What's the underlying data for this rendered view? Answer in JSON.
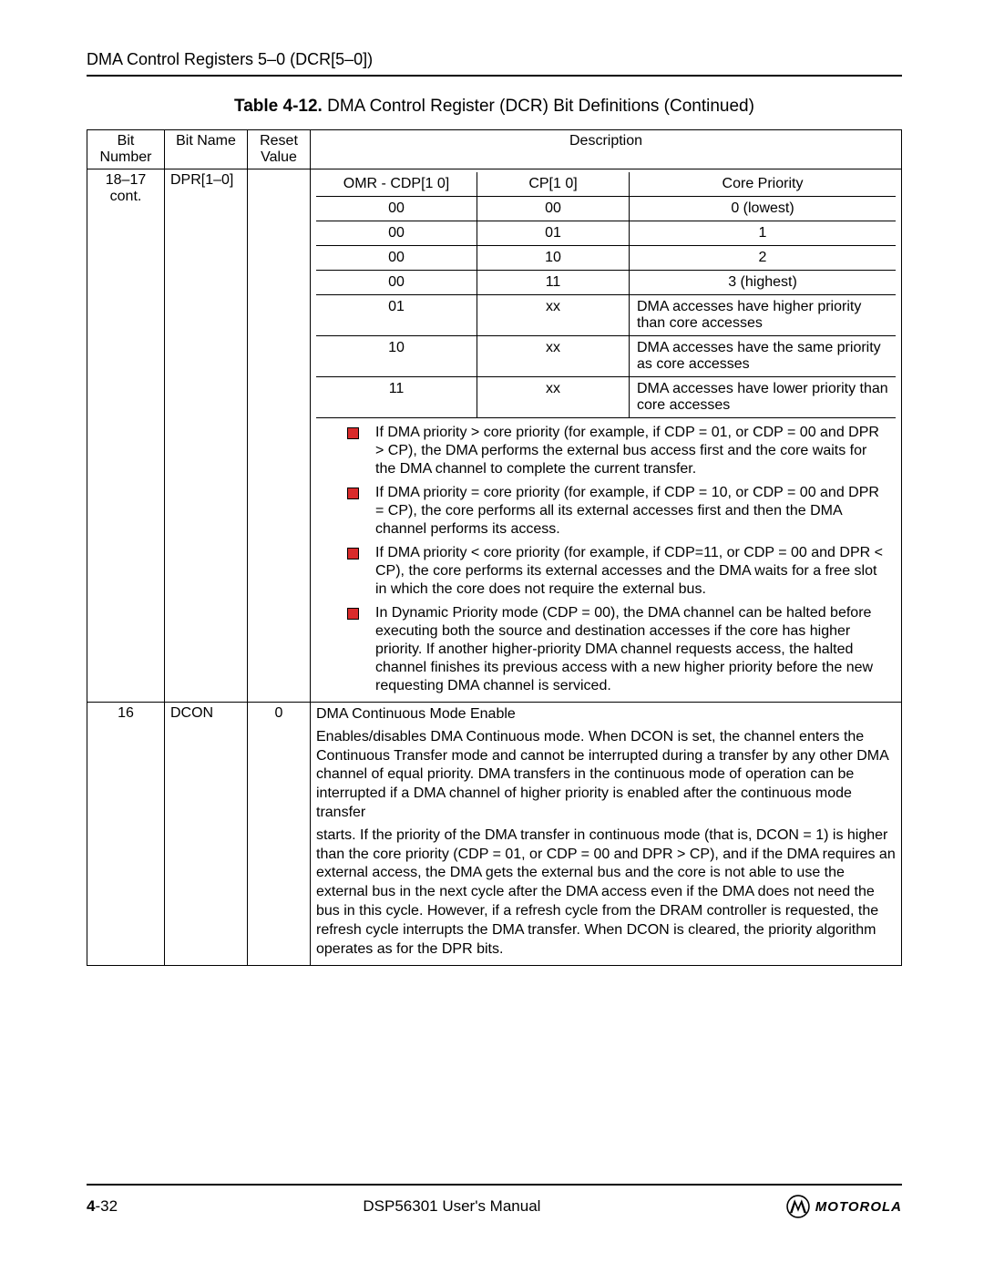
{
  "header": {
    "section_title": "DMA Control Registers 5–0 (DCR[5–0])"
  },
  "caption": {
    "label": "Table 4-12.",
    "title": " DMA Control Register (DCR) Bit Definitions (Continued)"
  },
  "columns": {
    "bit_number": "Bit Number",
    "bit_name": "Bit Name",
    "reset_value": "Reset Value",
    "description": "Description"
  },
  "row1": {
    "bit_number": "18–17 cont.",
    "bit_name": "DPR[1–0]",
    "reset_value": "",
    "inner_headers": {
      "c1": "OMR - CDP[1 0]",
      "c2": "CP[1 0]",
      "c3": "Core Priority"
    },
    "inner_rows": [
      {
        "c1": "00",
        "c2": "00",
        "c3": "0 (lowest)"
      },
      {
        "c1": "00",
        "c2": "01",
        "c3": "1"
      },
      {
        "c1": "00",
        "c2": "10",
        "c3": "2"
      },
      {
        "c1": "00",
        "c2": "11",
        "c3": "3 (highest)"
      },
      {
        "c1": "01",
        "c2": "xx",
        "c3": "DMA accesses have higher priority than core accesses"
      },
      {
        "c1": "10",
        "c2": "xx",
        "c3": "DMA accesses have the same priority as core accesses"
      },
      {
        "c1": "11",
        "c2": "xx",
        "c3": "DMA accesses have lower priority than core accesses"
      }
    ],
    "bullets": [
      "If DMA priority > core priority (for example, if CDP = 01, or CDP = 00 and DPR > CP), the DMA performs the external bus access first and the core waits for the DMA channel to complete the current transfer.",
      "If DMA priority = core priority (for example, if CDP = 10, or CDP = 00 and DPR = CP), the core performs all its external accesses first and then the DMA channel performs its access.",
      "If DMA priority < core priority (for example, if CDP=11, or CDP = 00 and DPR < CP), the core performs its external accesses and the DMA waits for a free slot in which the core does not require the external bus.",
      "In Dynamic Priority mode (CDP = 00), the DMA channel can be halted before executing both the source and destination accesses if the core has higher priority. If another higher-priority DMA channel requests access, the halted channel finishes its previous access with a new higher priority before the new requesting DMA channel is serviced."
    ]
  },
  "row2": {
    "bit_number": "16",
    "bit_name": "DCON",
    "reset_value": "0",
    "title": "DMA Continuous Mode Enable",
    "para1": "Enables/disables DMA Continuous mode. When DCON is set, the channel enters the Continuous Transfer mode and cannot be interrupted during a transfer by any other DMA channel of equal priority. DMA transfers in the continuous mode of operation can be interrupted if a DMA channel of higher priority is enabled after the continuous mode transfer",
    "para2": "starts. If the priority of the DMA transfer in continuous mode (that is, DCON = 1) is higher than the core priority (CDP = 01, or CDP = 00 and DPR > CP), and if the DMA requires an external access, the DMA gets the external bus and the core is not able to use the external bus in the next cycle after the DMA access even if the DMA does not need the bus in this cycle. However, if a refresh cycle from the DRAM controller is requested, the refresh cycle interrupts the DMA transfer. When DCON is cleared, the priority algorithm operates as for the DPR bits."
  },
  "footer": {
    "page_prefix": "4",
    "page_suffix": "-32",
    "manual": "DSP56301 User's Manual",
    "brand": "MOTOROLA"
  }
}
